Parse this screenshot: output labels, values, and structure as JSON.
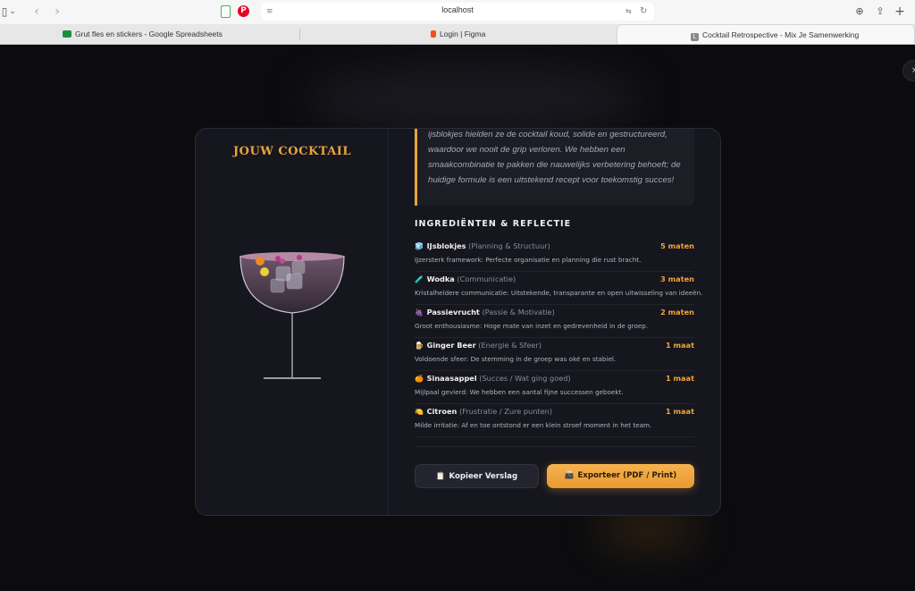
{
  "browser": {
    "url": "localhost",
    "tabs": [
      {
        "label": "Grut fles en stickers - Google Spreadsheets",
        "favicon_color": "#1e8e3e"
      },
      {
        "label": "Login | Figma",
        "favicon_color": "#f24e1e"
      },
      {
        "label": "Cocktail Retrospective - Mix Je Samenwerking",
        "favicon_color": "#8a8a8a",
        "favicon_letter": "L"
      }
    ],
    "close_label": "×"
  },
  "modal": {
    "title": "JOUW COCKTAIL",
    "summary": "ijsblokjes hielden ze de cocktail koud, solide en gestructureerd, waardoor we nooit de grip verloren. We hebben een smaakcombinatie te pakken die nauwelijks verbetering behoeft; de huidige formule is een uitstekend recept voor toekomstig succes!",
    "section_title": "INGREDIËNTEN & REFLECTIE",
    "ingredients": [
      {
        "emoji": "🧊",
        "name": "IJsblokjes",
        "category": "(Planning & Structuur)",
        "amount": "5 maten",
        "note": "IJzersterk framework: Perfecte organisatie en planning die rust bracht."
      },
      {
        "emoji": "🧪",
        "name": "Wodka",
        "category": "(Communicatie)",
        "amount": "3 maten",
        "note": "Kristalheldere communicatie: Uitstekende, transparante en open uitwisseling van ideeën."
      },
      {
        "emoji": "🍇",
        "name": "Passievrucht",
        "category": "(Passie & Motivatie)",
        "amount": "2 maten",
        "note": "Groot enthousiasme: Hoge mate van inzet en gedrevenheid in de groep."
      },
      {
        "emoji": "🍺",
        "name": "Ginger Beer",
        "category": "(Energie & Sfeer)",
        "amount": "1 maat",
        "note": "Voldoende sfeer: De stemming in de groep was oké en stabiel."
      },
      {
        "emoji": "🍊",
        "name": "Sinaasappel",
        "category": "(Succes / Wat ging goed)",
        "amount": "1 maat",
        "note": "Mijlpaal gevierd: We hebben een aantal fijne successen geboekt."
      },
      {
        "emoji": "🍋",
        "name": "Citroen",
        "category": "(Frustratie / Zure punten)",
        "amount": "1 maat",
        "note": "Milde irritatie: Af en toe ontstond er een klein stroef moment in het team."
      }
    ],
    "copy_button": {
      "icon": "📋",
      "label": "Kopieer Verslag"
    },
    "export_button": {
      "icon": "📠",
      "label": "Exporteer (PDF / Print)"
    },
    "colors": {
      "accent": "#e8a43c",
      "background": "#16161e"
    }
  }
}
